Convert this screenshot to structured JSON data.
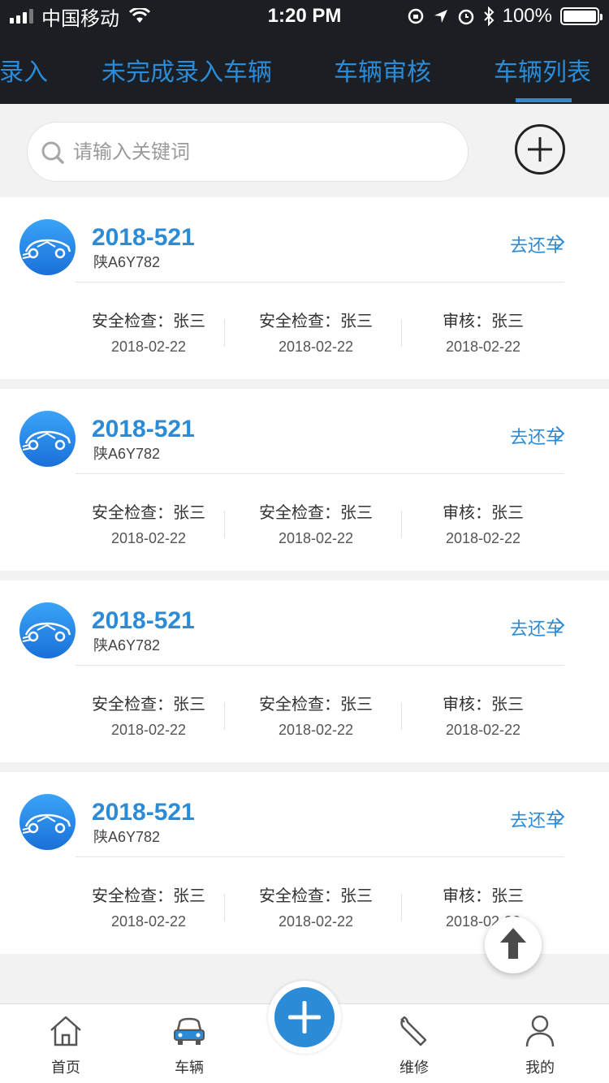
{
  "status_bar": {
    "carrier": "中国移动",
    "time": "1:20 PM",
    "battery": "100%"
  },
  "tabs": [
    {
      "label": "录入"
    },
    {
      "label": "未完成录入车辆"
    },
    {
      "label": "车辆审核"
    },
    {
      "label": "车辆列表",
      "active": true
    }
  ],
  "search": {
    "placeholder": "请输入关键词",
    "value": ""
  },
  "cards": [
    {
      "title": "2018-521",
      "plate": "陕A6Y782",
      "action": "去还车",
      "stats": [
        {
          "label": "安全检查：张三",
          "date": "2018-02-22"
        },
        {
          "label": "安全检查：张三",
          "date": "2018-02-22"
        },
        {
          "label": "审核：张三",
          "date": "2018-02-22"
        }
      ]
    },
    {
      "title": "2018-521",
      "plate": "陕A6Y782",
      "action": "去还车",
      "stats": [
        {
          "label": "安全检查：张三",
          "date": "2018-02-22"
        },
        {
          "label": "安全检查：张三",
          "date": "2018-02-22"
        },
        {
          "label": "审核：张三",
          "date": "2018-02-22"
        }
      ]
    },
    {
      "title": "2018-521",
      "plate": "陕A6Y782",
      "action": "去还车",
      "stats": [
        {
          "label": "安全检查：张三",
          "date": "2018-02-22"
        },
        {
          "label": "安全检查：张三",
          "date": "2018-02-22"
        },
        {
          "label": "审核：张三",
          "date": "2018-02-22"
        }
      ]
    },
    {
      "title": "2018-521",
      "plate": "陕A6Y782",
      "action": "去还车",
      "stats": [
        {
          "label": "安全检查：张三",
          "date": "2018-02-22"
        },
        {
          "label": "安全检查：张三",
          "date": "2018-02-22"
        },
        {
          "label": "审核：张三",
          "date": "2018-02-22"
        }
      ]
    }
  ],
  "bottom_nav": [
    {
      "label": "首页",
      "icon": "home-icon"
    },
    {
      "label": "车辆",
      "icon": "car-icon",
      "active": true
    },
    {
      "label": "维修",
      "icon": "wrench-icon"
    },
    {
      "label": "我的",
      "icon": "user-icon"
    }
  ],
  "colors": {
    "accent": "#2b8bd6",
    "header_bg": "#1b1e23",
    "page_bg": "#f2f2f2"
  }
}
